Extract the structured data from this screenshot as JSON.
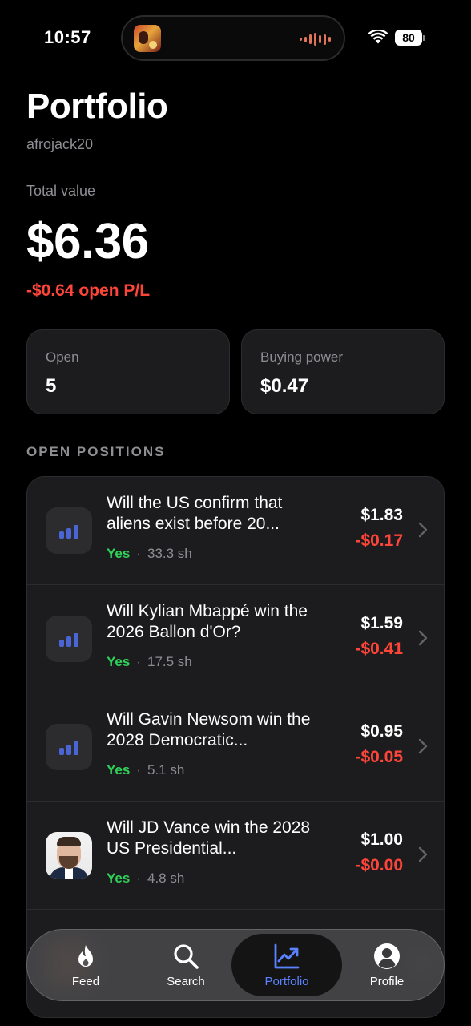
{
  "status_bar": {
    "time": "10:57",
    "battery": "80"
  },
  "header": {
    "title": "Portfolio",
    "username": "afrojack20"
  },
  "summary": {
    "total_label": "Total value",
    "total_value": "$6.36",
    "open_pl": "-$0.64 open P/L"
  },
  "stats": {
    "open_label": "Open",
    "open_value": "5",
    "buying_power_label": "Buying power",
    "buying_power_value": "$0.47"
  },
  "section_title": "OPEN POSITIONS",
  "positions": [
    {
      "title": "Will the US confirm that aliens exist before 20...",
      "side": "Yes",
      "shares": "33.3 sh",
      "value": "$1.83",
      "pl": "-$0.17",
      "thumb": "bar-chart-icon"
    },
    {
      "title": "Will Kylian Mbappé win the 2026 Ballon d'Or?",
      "side": "Yes",
      "shares": "17.5 sh",
      "value": "$1.59",
      "pl": "-$0.41",
      "thumb": "bar-chart-icon"
    },
    {
      "title": "Will Gavin Newsom win the 2028 Democratic...",
      "side": "Yes",
      "shares": "5.1 sh",
      "value": "$0.95",
      "pl": "-$0.05",
      "thumb": "bar-chart-icon"
    },
    {
      "title": "Will JD Vance win the 2028 US Presidential...",
      "side": "Yes",
      "shares": "4.8 sh",
      "value": "$1.00",
      "pl": "-$0.00",
      "thumb": "portrait-photo"
    }
  ],
  "tab_bar": {
    "tabs": [
      {
        "label": "Feed",
        "icon": "flame-icon"
      },
      {
        "label": "Search",
        "icon": "search-icon"
      },
      {
        "label": "Portfolio",
        "icon": "chart-trend-icon",
        "active": true
      },
      {
        "label": "Profile",
        "icon": "person-icon"
      }
    ]
  },
  "colors": {
    "background": "#000000",
    "card": "#1c1c1e",
    "negative": "#ff453a",
    "positive": "#30d158",
    "accent": "#5b82ff",
    "muted_text": "#8e8e93",
    "thumb_bar": "#4a66d6"
  }
}
